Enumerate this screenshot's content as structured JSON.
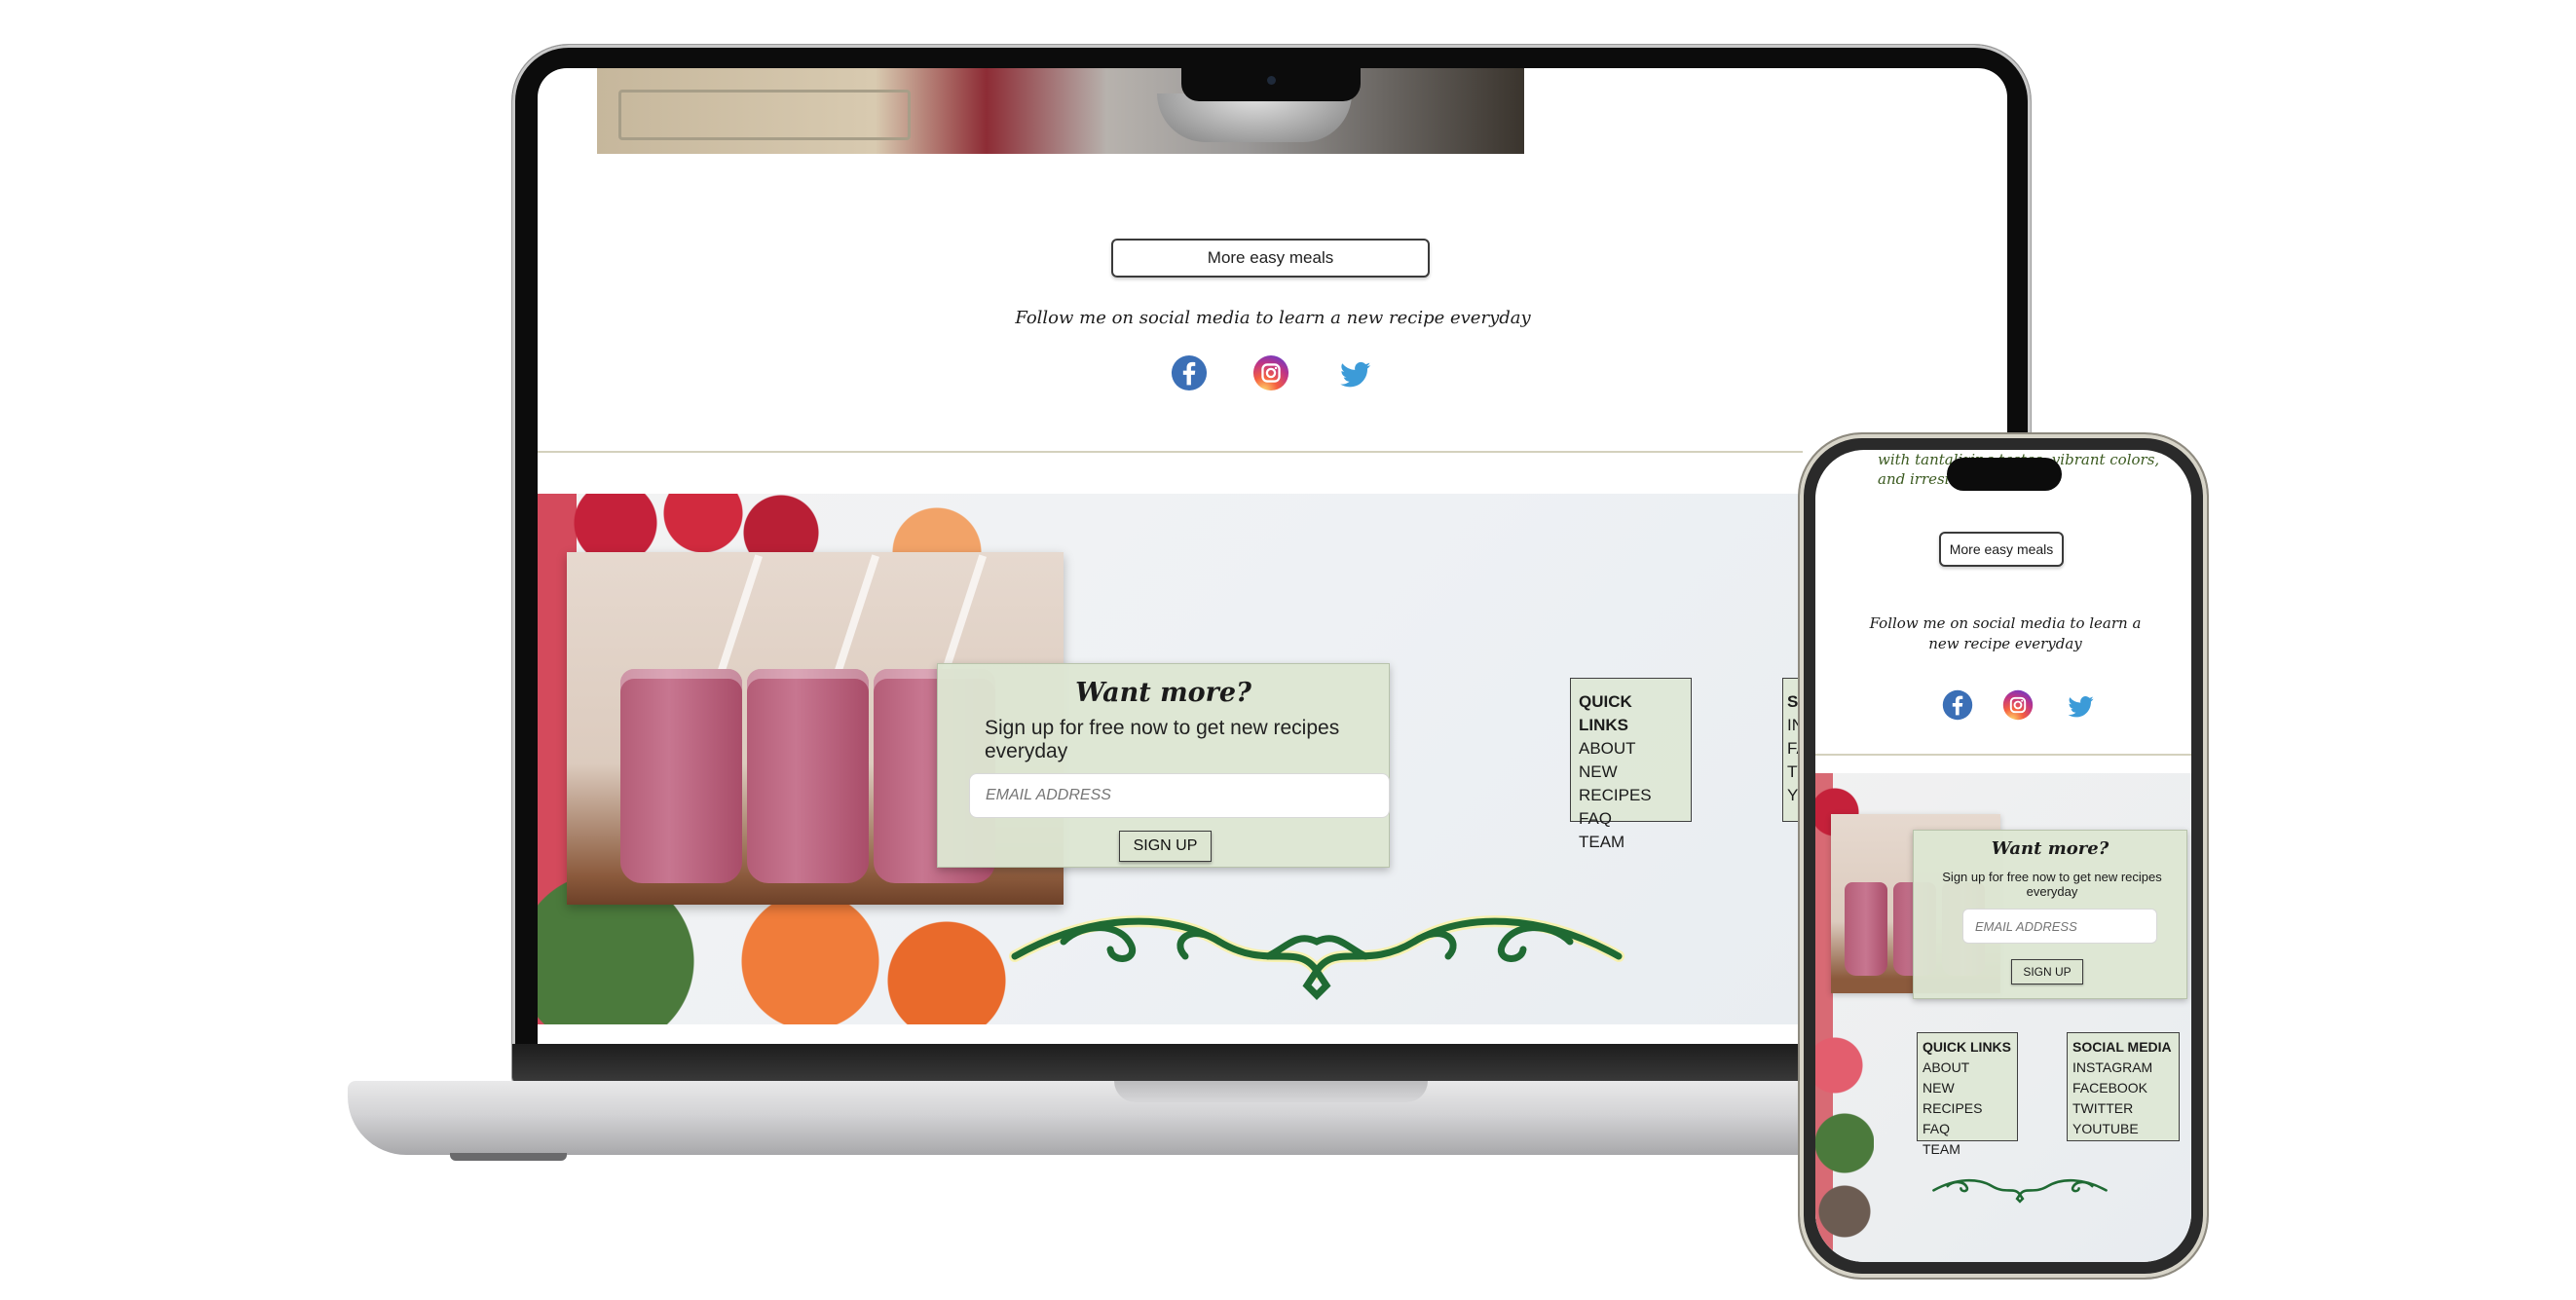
{
  "laptop": {
    "more_button": "More easy meals",
    "follow_text": "Follow me on social media to learn a new recipe everyday",
    "signup": {
      "title": "Want more?",
      "subtitle": "Sign up for free now to get new recipes everyday",
      "email_placeholder": "EMAIL ADDRESS",
      "button": "SIGN UP"
    },
    "quick_links": {
      "heading": "QUICK LINKS",
      "items": [
        "ABOUT",
        "NEW RECIPES",
        "FAQ",
        "TEAM"
      ]
    },
    "social_media_partial": {
      "heading": "SO",
      "items": [
        "IN",
        "FA",
        "TV",
        "YO"
      ]
    }
  },
  "phone": {
    "top_text_line1": "with tantalizing tastes, vibrant colors,",
    "top_text_line2": "and irresi",
    "more_button": "More easy meals",
    "follow_text": "Follow me on social media to learn a new recipe everyday",
    "signup": {
      "title": "Want more?",
      "subtitle": "Sign up for free now to get new recipes everyday",
      "email_placeholder": "EMAIL ADDRESS",
      "button": "SIGN UP"
    },
    "quick_links": {
      "heading": "QUICK LINKS",
      "items": [
        "ABOUT",
        "NEW RECIPES",
        "FAQ",
        "TEAM"
      ]
    },
    "social_media": {
      "heading": "SOCIAL MEDIA",
      "items": [
        "INSTAGRAM",
        "FACEBOOK",
        "TWITTER",
        "YOUTUBE"
      ]
    }
  },
  "icons": {
    "facebook": "facebook-icon",
    "instagram": "instagram-icon",
    "twitter": "twitter-icon"
  },
  "colors": {
    "card_green": "#dde6d2",
    "ornament_green": "#1f6a33",
    "facebook_blue": "#3b6fb6",
    "twitter_blue": "#3c9bd8"
  }
}
